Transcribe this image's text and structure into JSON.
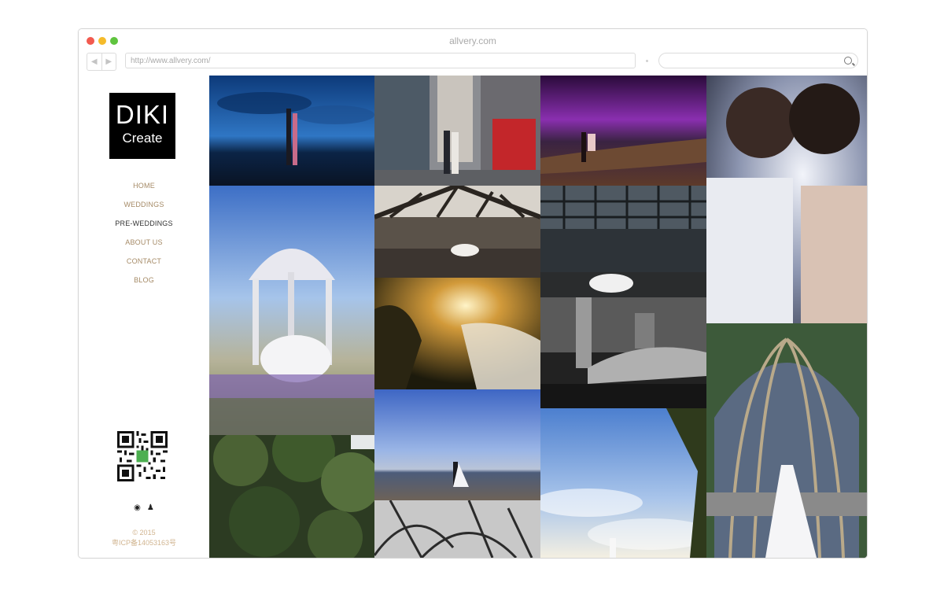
{
  "window": {
    "title": "allvery.com",
    "url": "http://www.allvery.com/",
    "search_placeholder": ""
  },
  "logo": {
    "line1": "DIKI",
    "line2": "Create"
  },
  "menu": [
    {
      "label": "HOME",
      "active": false
    },
    {
      "label": "WEDDINGS",
      "active": false
    },
    {
      "label": "PRE-WEDDINGS",
      "active": true
    },
    {
      "label": "ABOUT US",
      "active": false
    },
    {
      "label": "CONTACT",
      "active": false
    },
    {
      "label": "BLOG",
      "active": false
    }
  ],
  "social": {
    "weibo_icon": "weibo-icon",
    "qq_icon": "qq-icon"
  },
  "footer": {
    "copyright": "© 2015",
    "icp": "粤ICP备14053163号"
  },
  "colors": {
    "menu_text": "#a58a66",
    "menu_active": "#333333",
    "footer_text": "#d1b591"
  }
}
